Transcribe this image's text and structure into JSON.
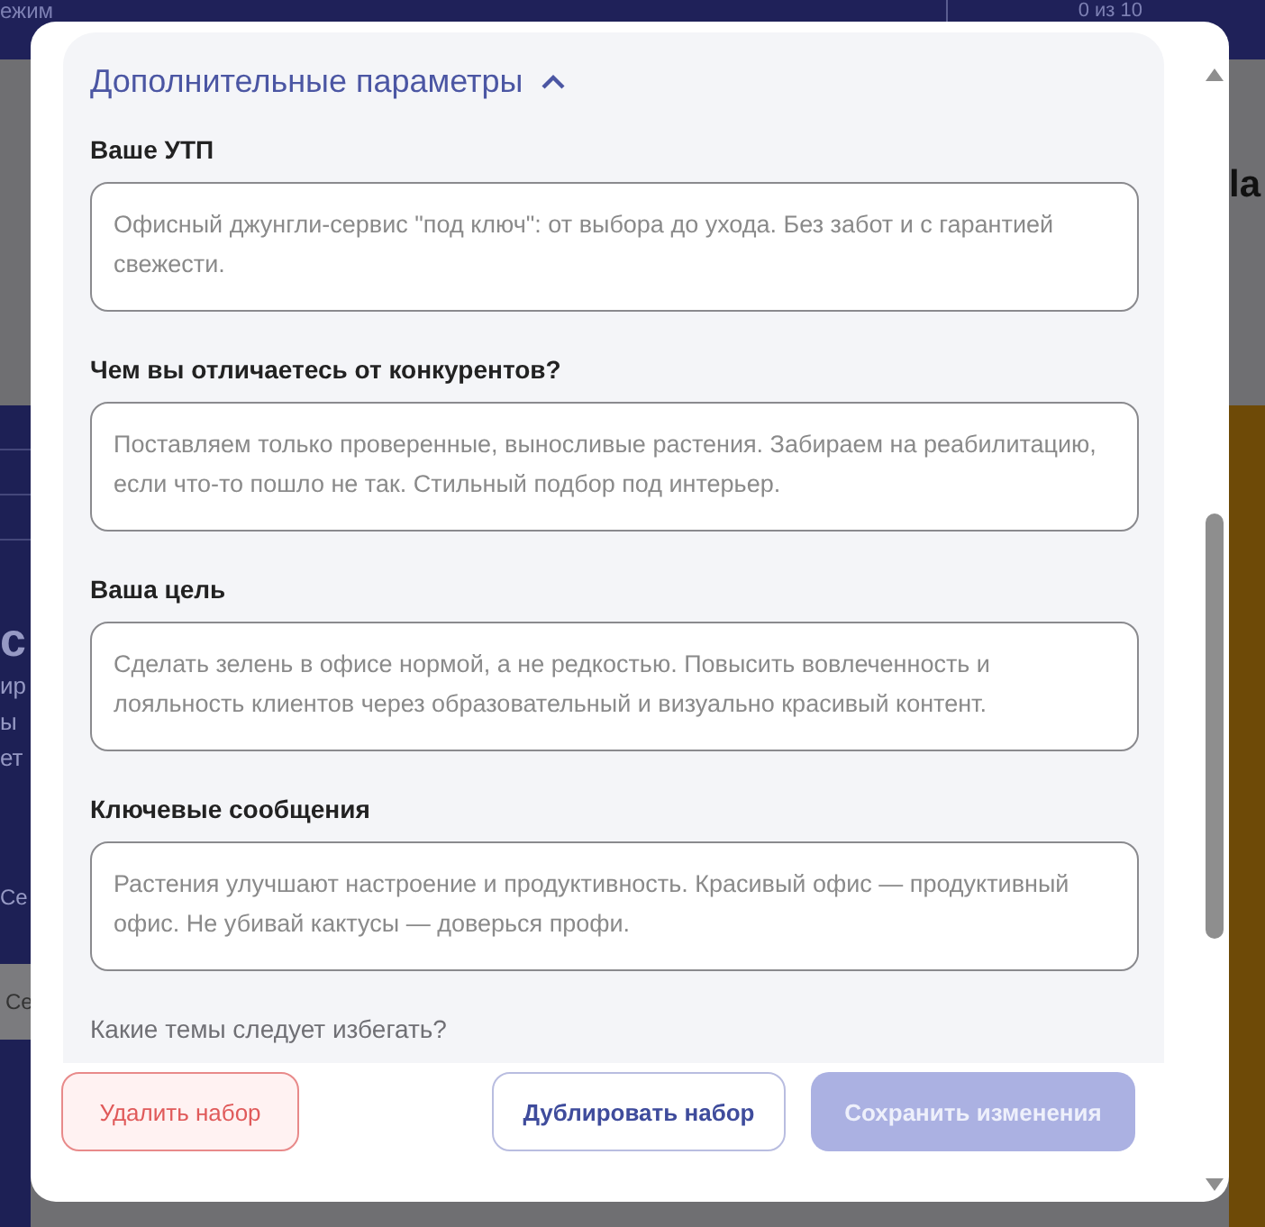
{
  "background": {
    "header_left": "ежим",
    "header_counter": "0 из 10",
    "right_heading": "la",
    "left_heading": "с",
    "left_lines": [
      "ир",
      "ы",
      "ет"
    ],
    "left_items": [
      "Се",
      "Се"
    ]
  },
  "section": {
    "title": "Дополнительные параметры",
    "expanded": true
  },
  "fields": [
    {
      "label": "Ваше УТП",
      "placeholder": "Офисный джунгли-сервис \"под ключ\": от выбора до ухода. Без забот и с гарантией свежести."
    },
    {
      "label": "Чем вы отличаетесь от конкурентов?",
      "placeholder": "Поставляем только проверенные, выносливые растения. Забираем на реабилитацию, если что-то пошло не так. Стильный подбор под интерьер."
    },
    {
      "label": "Ваша цель",
      "placeholder": "Сделать зелень в офисе нормой, а не редкостью. Повысить вовлеченность и лояльность клиентов через образовательный и визуально красивый контент."
    },
    {
      "label": "Ключевые сообщения",
      "placeholder": "Растения улучшают настроение и продуктивность. Красивый офис — продуктивный офис. Не убивай кактусы — доверься профи."
    }
  ],
  "next_label": "Какие темы следует избегать?",
  "buttons": [
    {
      "kind": "danger",
      "label": "Удалить набор",
      "disabled": false
    },
    {
      "kind": "outline",
      "label": "Дублировать набор",
      "disabled": false
    },
    {
      "kind": "primary",
      "label": "Сохранить изменения",
      "disabled": true
    }
  ]
}
